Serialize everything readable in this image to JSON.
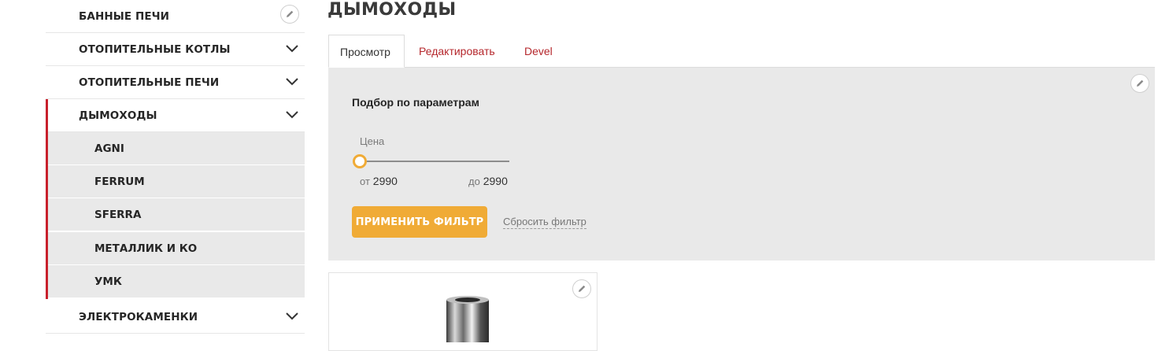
{
  "sidebar": {
    "items": [
      {
        "label": "БАННЫЕ ПЕЧИ"
      },
      {
        "label": "ОТОПИТЕЛЬНЫЕ КОТЛЫ"
      },
      {
        "label": "ОТОПИТЕЛЬНЫЕ ПЕЧИ"
      },
      {
        "label": "ДЫМОХОДЫ"
      },
      {
        "label": "ЭЛЕКТРОКАМЕНКИ"
      }
    ],
    "subitems": [
      {
        "label": "AGNI"
      },
      {
        "label": "FERRUM"
      },
      {
        "label": "SFERRA"
      },
      {
        "label": "МЕТАЛЛИК И КО"
      },
      {
        "label": "УМК"
      }
    ]
  },
  "page": {
    "title": "ДЫМОХОДЫ"
  },
  "tabs": [
    {
      "label": "Просмотр",
      "active": true
    },
    {
      "label": "Редактировать",
      "active": false
    },
    {
      "label": "Devel",
      "active": false
    }
  ],
  "filter": {
    "title": "Подбор по параметрам",
    "price_label": "Цена",
    "from_prefix": "от",
    "from_value": "2990",
    "to_prefix": "до",
    "to_value": "2990",
    "apply_label": "ПРИМЕНИТЬ ФИЛЬТР",
    "reset_label": "Сбросить фильтр",
    "slider_position": 0
  },
  "colors": {
    "accent_red": "#c8202c",
    "button_orange": "#f0ab36",
    "tab_link": "#b5272c"
  },
  "icons": {
    "edit": "pencil-icon",
    "chevron": "chevron-down-icon"
  }
}
